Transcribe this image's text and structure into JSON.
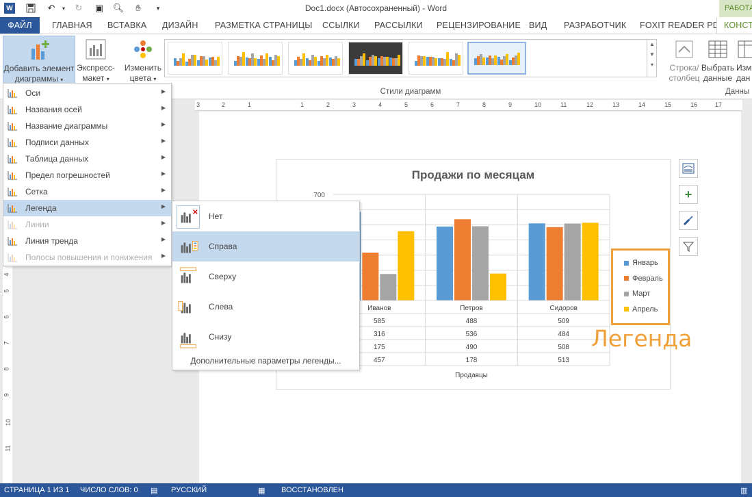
{
  "window": {
    "title": "Doc1.docx (Автосохраненный) - Word",
    "context_tab": "РАБОТА"
  },
  "tabs": [
    "ФАЙЛ",
    "ГЛАВНАЯ",
    "ВСТАВКА",
    "ДИЗАЙН",
    "РАЗМЕТКА СТРАНИЦЫ",
    "ССЫЛКИ",
    "РАССЫЛКИ",
    "РЕЦЕНЗИРОВАНИЕ",
    "ВИД",
    "РАЗРАБОТЧИК",
    "FOXIT READER PDF",
    "КОНСТ"
  ],
  "ribbon": {
    "add_element_line1": "Добавить элемент",
    "add_element_line2": "диаграммы",
    "express_line1": "Экспресс-",
    "express_line2": "макет",
    "colors_line1": "Изменить",
    "colors_line2": "цвета",
    "styles_group": "Стили диаграмм",
    "row_col_line1": "Строка/",
    "row_col_line2": "столбец",
    "select_data_line1": "Выбрать",
    "select_data_line2": "данные",
    "edit_line1": "Изм",
    "edit_line2": "дан",
    "data_group": "Данны"
  },
  "menu": {
    "items": [
      {
        "label": "Оси",
        "state": "normal"
      },
      {
        "label": "Названия осей",
        "state": "normal"
      },
      {
        "label": "Название диаграммы",
        "state": "normal"
      },
      {
        "label": "Подписи данных",
        "state": "normal"
      },
      {
        "label": "Таблица данных",
        "state": "normal"
      },
      {
        "label": "Предел погрешностей",
        "state": "normal"
      },
      {
        "label": "Сетка",
        "state": "normal"
      },
      {
        "label": "Легенда",
        "state": "active"
      },
      {
        "label": "Линии",
        "state": "disabled"
      },
      {
        "label": "Линия тренда",
        "state": "normal"
      },
      {
        "label": "Полосы повышения и понижения",
        "state": "disabled"
      }
    ]
  },
  "submenu": {
    "items": [
      {
        "label": "Нет",
        "icon": "legend-none-icon"
      },
      {
        "label": "Справа",
        "icon": "legend-right-icon"
      },
      {
        "label": "Сверху",
        "icon": "legend-top-icon"
      },
      {
        "label": "Слева",
        "icon": "legend-left-icon"
      },
      {
        "label": "Снизу",
        "icon": "legend-bottom-icon"
      }
    ],
    "selected": "Справа",
    "more": "Дополнительные параметры легенды..."
  },
  "chart_data": {
    "type": "bar",
    "title": "Продажи по месяцам",
    "categories": [
      "Иванов",
      "Петров",
      "Сидоров"
    ],
    "series": [
      {
        "name": "Январь",
        "color": "#5b9bd5",
        "values": [
          585,
          488,
          509
        ]
      },
      {
        "name": "Февраль",
        "color": "#ed7d31",
        "values": [
          316,
          536,
          484
        ]
      },
      {
        "name": "Март",
        "color": "#a5a5a5",
        "values": [
          175,
          490,
          508
        ]
      },
      {
        "name": "Апрель",
        "color": "#ffc000",
        "values": [
          457,
          178,
          513
        ]
      }
    ],
    "xlabel": "Продавцы",
    "ylim": [
      0,
      700
    ],
    "visible_ytick": "700",
    "grid": true,
    "data_table": true,
    "legend_position": "right"
  },
  "annotation": "Легенда",
  "statusbar": {
    "page": "СТРАНИЦА 1 ИЗ 1",
    "words": "ЧИСЛО СЛОВ: 0",
    "language": "РУССКИЙ",
    "restored": "ВОССТАНОВЛЕН"
  },
  "ruler": [
    "3",
    "2",
    "1",
    "1",
    "2",
    "3",
    "4",
    "5",
    "6",
    "7",
    "8",
    "9",
    "10",
    "11",
    "12",
    "13",
    "14",
    "15",
    "16",
    "17"
  ],
  "vruler": [
    "4",
    "5",
    "6",
    "7",
    "8",
    "9",
    "10",
    "11"
  ]
}
